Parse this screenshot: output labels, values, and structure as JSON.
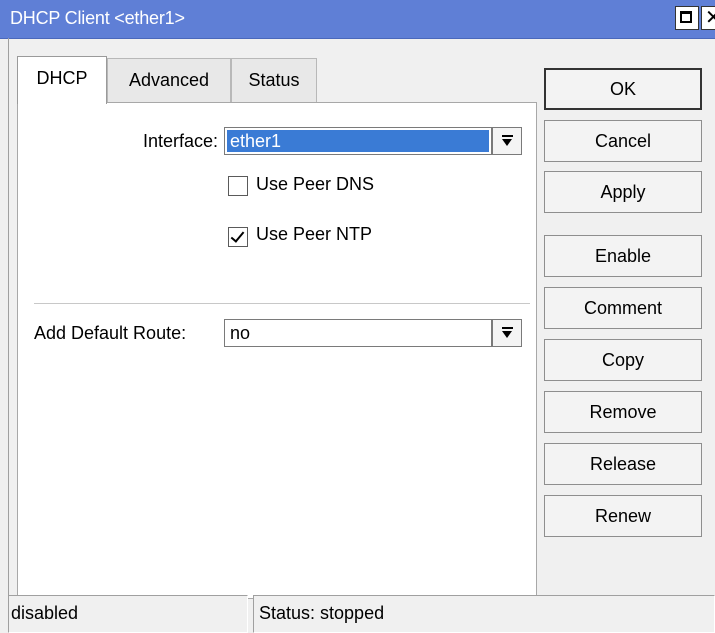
{
  "window": {
    "title": "DHCP Client <ether1>"
  },
  "tabs": [
    {
      "label": "DHCP",
      "active": true
    },
    {
      "label": "Advanced",
      "active": false
    },
    {
      "label": "Status",
      "active": false
    }
  ],
  "form": {
    "interface": {
      "label": "Interface:",
      "value": "ether1",
      "selected": true
    },
    "use_peer_dns": {
      "label": "Use Peer DNS",
      "checked": false
    },
    "use_peer_ntp": {
      "label": "Use Peer NTP",
      "checked": true
    },
    "add_default_route": {
      "label": "Add Default Route:",
      "value": "no"
    }
  },
  "buttons": {
    "ok": "OK",
    "cancel": "Cancel",
    "apply": "Apply",
    "enable": "Enable",
    "comment": "Comment",
    "copy": "Copy",
    "remove": "Remove",
    "release": "Release",
    "renew": "Renew"
  },
  "statusbar": {
    "state": "disabled",
    "status": "Status: stopped"
  },
  "colors": {
    "titlebar": "#5f7fd6",
    "selection": "#3a7bd5",
    "window_bg": "#f0f0f0"
  },
  "icons": {
    "maximize": "maximize-icon",
    "close": "close-icon",
    "dropdown": "dropdown-arrow-icon",
    "checkmark": "checkmark-icon"
  }
}
